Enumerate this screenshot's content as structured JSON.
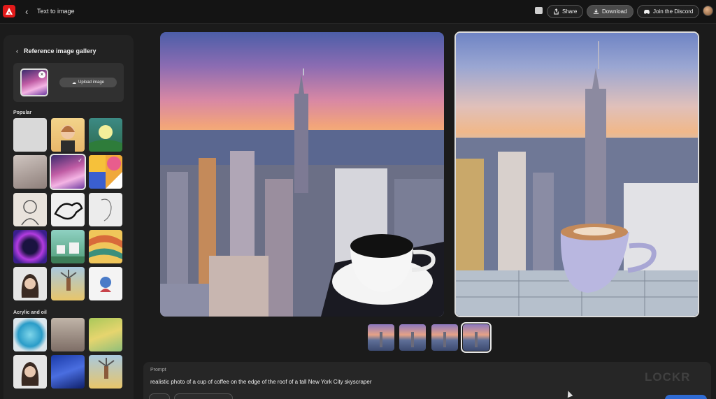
{
  "header": {
    "breadcrumb": "Text to image",
    "share_label": "Share",
    "download_label": "Download",
    "discord_label": "Join the Discord"
  },
  "sidebar": {
    "title": "Reference image gallery",
    "upload_label": "Upload image",
    "sections": [
      {
        "label": "Popular"
      },
      {
        "label": "Acrylic and oil"
      }
    ]
  },
  "prompt": {
    "label": "Prompt",
    "text": "realistic photo of a cup of coffee on the edge of the roof of a tall New York City skyscraper"
  },
  "watermark": "LOCKR",
  "colors": {
    "accent": "#2f6bd4",
    "brand": "#e21a1a"
  }
}
